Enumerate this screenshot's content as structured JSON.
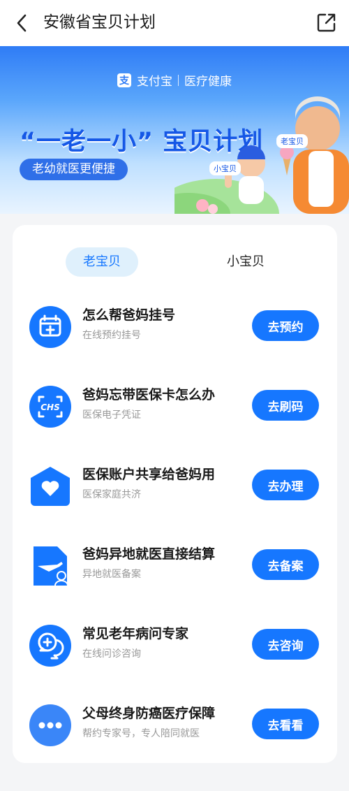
{
  "header": {
    "title": "安徽省宝贝计划",
    "back_icon": "chevron-left-icon",
    "share_icon": "share-icon"
  },
  "banner": {
    "brand_name": "支付宝",
    "brand_logo_char": "支",
    "brand_sub": "医疗健康",
    "slogan": "“一老一小” 宝贝计划",
    "pill": "老幼就医更便捷",
    "tag_old": "老宝贝",
    "tag_young": "小宝贝"
  },
  "tabs": [
    {
      "label": "老宝贝",
      "active": true
    },
    {
      "label": "小宝贝",
      "active": false
    }
  ],
  "items": [
    {
      "title": "怎么帮爸妈挂号",
      "subtitle": "在线预约挂号",
      "button": "去预约",
      "icon": "calendar-plus-icon"
    },
    {
      "title": "爸妈忘带医保卡怎么办",
      "subtitle": "医保电子凭证",
      "button": "去刷码",
      "icon": "chs-card-icon"
    },
    {
      "title": "医保账户共享给爸妈用",
      "subtitle": "医保家庭共济",
      "button": "去办理",
      "icon": "heart-house-icon"
    },
    {
      "title": "爸妈异地就医直接结算",
      "subtitle": "异地就医备案",
      "button": "去备案",
      "icon": "plane-document-icon"
    },
    {
      "title": "常见老年病问专家",
      "subtitle": "在线问诊咨询",
      "button": "去咨询",
      "icon": "consult-chat-icon"
    },
    {
      "title": "父母终身防癌医疗保障",
      "subtitle": "帮约专家号，专人陪同就医",
      "button": "去看看",
      "icon": "more-dots-icon"
    }
  ],
  "colors": {
    "accent": "#1677ff",
    "tab_bg": "#dff0fc"
  }
}
